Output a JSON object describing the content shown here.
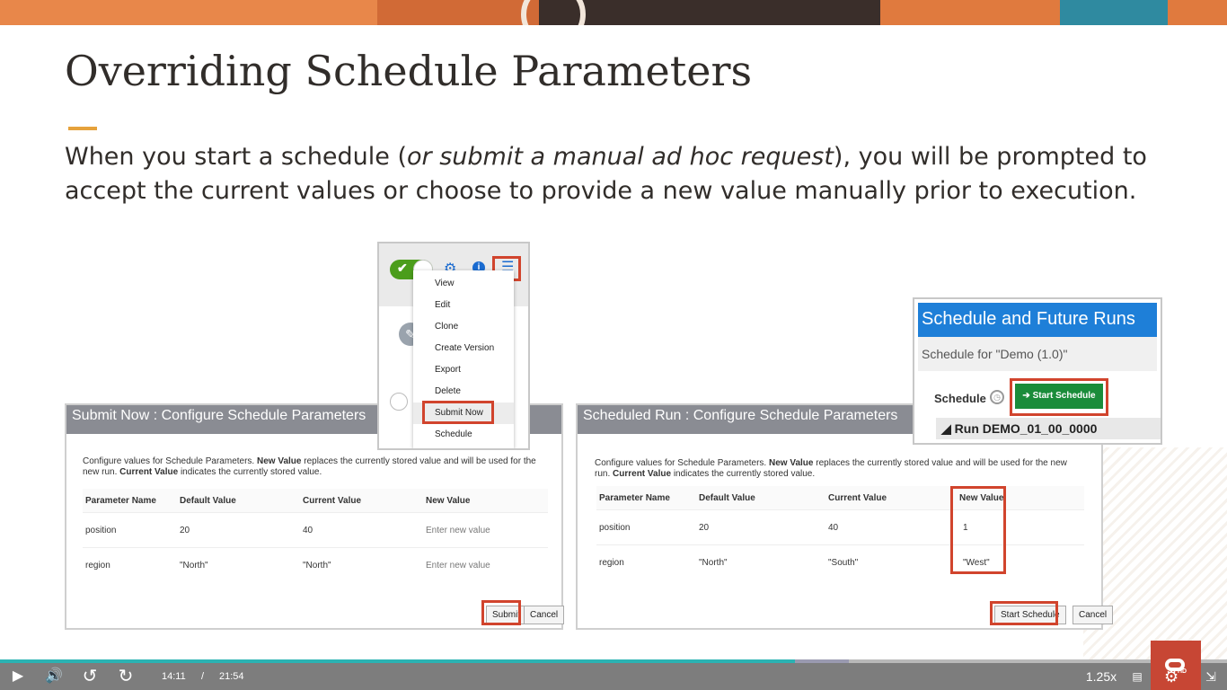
{
  "slide": {
    "title": "Overriding Schedule Parameters",
    "desc_before": "When you start a schedule (",
    "desc_italic": "or submit a manual ad hoc request",
    "desc_after": "), you will be prompted to accept the current values or choose to provide a new value manually prior to execution."
  },
  "submit_dialog": {
    "title": "Submit Now : Configure Schedule Parameters",
    "info_1": "Configure values for Schedule Parameters. ",
    "info_bold_1": "New Value",
    "info_2": " replaces the currently stored value and will be used for the new run. ",
    "info_bold_2": "Current Value",
    "info_3": " indicates the currently stored value.",
    "headers": [
      "Parameter Name",
      "Default Value",
      "Current Value",
      "New Value"
    ],
    "rows": [
      {
        "name": "position",
        "default": "20",
        "current": "40",
        "new": "Enter new value"
      },
      {
        "name": "region",
        "default": "\"North\"",
        "current": "\"North\"",
        "new": "Enter new value"
      }
    ],
    "submit_label": "Submit",
    "cancel_label": "Cancel"
  },
  "scheduled_dialog": {
    "title": "Scheduled Run : Configure Schedule Parameters",
    "info_1": "Configure values for Schedule Parameters. ",
    "info_bold_1": "New Value",
    "info_2": " replaces the currently stored value and will be used for the new run. ",
    "info_bold_2": "Current Value",
    "info_3": " indicates the currently stored value.",
    "headers": [
      "Parameter Name",
      "Default Value",
      "Current Value",
      "New Value"
    ],
    "rows": [
      {
        "name": "position",
        "default": "20",
        "current": "40",
        "new": "1"
      },
      {
        "name": "region",
        "default": "\"North\"",
        "current": "\"South\"",
        "new": "\"West\""
      }
    ],
    "start_label": "Start Schedule",
    "cancel_label": "Cancel"
  },
  "action_menu": {
    "items": [
      "View",
      "Edit",
      "Clone",
      "Create Version",
      "Export",
      "Delete",
      "Submit Now",
      "Schedule"
    ],
    "active_item": "Submit Now"
  },
  "schedule_panel": {
    "title": "Schedule and Future Runs",
    "subtitle": "Schedule for \"Demo (1.0)\"",
    "schedule_label": "Schedule",
    "start_button": "Start Schedule",
    "run_label": "Run DEMO_01_00_0000"
  },
  "player": {
    "current_time": "14:11",
    "separator": "/",
    "duration": "21:54",
    "speed": "1.25x",
    "hd_badge": "HD",
    "progress_fraction": 0.648,
    "icons": [
      "play-icon",
      "volume-icon",
      "replay-icon",
      "forward-icon",
      "captions-icon",
      "settings-icon",
      "exit-fullscreen-icon"
    ]
  },
  "colors": {
    "highlight": "#d1442d",
    "accent": "#e6a23c",
    "dialog_title_bg": "#8a8c93",
    "panel_title_bg": "#1e7fd8",
    "start_button_bg": "#1a8c3a",
    "progress": "#2bb3b3",
    "brand": "#c74634"
  }
}
